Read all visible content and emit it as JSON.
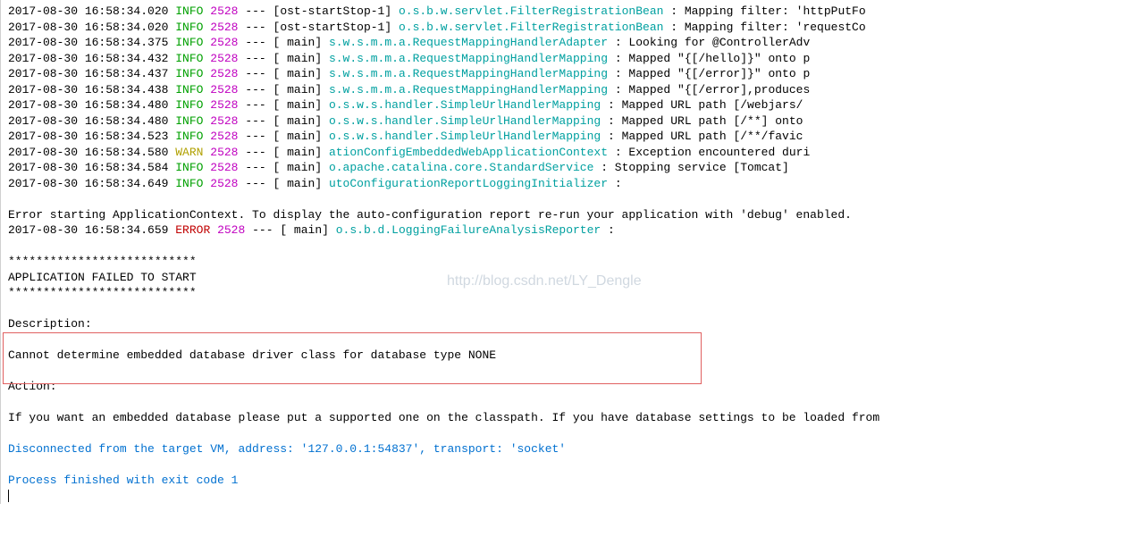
{
  "watermark": "http://blog.csdn.net/LY_Dengle",
  "log_lines": [
    {
      "ts": "2017-08-30 16:58:34.020",
      "lvl": "INFO",
      "pid": "2528",
      "sep": "---",
      "thread": "[ost-startStop-1]",
      "logger": "o.s.b.w.servlet.FilterRegistrationBean    ",
      "msg": ": Mapping filter: 'httpPutFo"
    },
    {
      "ts": "2017-08-30 16:58:34.020",
      "lvl": "INFO",
      "pid": "2528",
      "sep": "---",
      "thread": "[ost-startStop-1]",
      "logger": "o.s.b.w.servlet.FilterRegistrationBean    ",
      "msg": ": Mapping filter: 'requestCo"
    },
    {
      "ts": "2017-08-30 16:58:34.375",
      "lvl": "INFO",
      "pid": "2528",
      "sep": "---",
      "thread": "[           main]",
      "logger": "s.w.s.m.m.a.RequestMappingHandlerAdapter  ",
      "msg": ": Looking for @ControllerAdv"
    },
    {
      "ts": "2017-08-30 16:58:34.432",
      "lvl": "INFO",
      "pid": "2528",
      "sep": "---",
      "thread": "[           main]",
      "logger": "s.w.s.m.m.a.RequestMappingHandlerMapping  ",
      "msg": ": Mapped \"{[/hello]}\" onto p"
    },
    {
      "ts": "2017-08-30 16:58:34.437",
      "lvl": "INFO",
      "pid": "2528",
      "sep": "---",
      "thread": "[           main]",
      "logger": "s.w.s.m.m.a.RequestMappingHandlerMapping  ",
      "msg": ": Mapped \"{[/error]}\" onto p"
    },
    {
      "ts": "2017-08-30 16:58:34.438",
      "lvl": "INFO",
      "pid": "2528",
      "sep": "---",
      "thread": "[           main]",
      "logger": "s.w.s.m.m.a.RequestMappingHandlerMapping  ",
      "msg": ": Mapped \"{[/error],produces"
    },
    {
      "ts": "2017-08-30 16:58:34.480",
      "lvl": "INFO",
      "pid": "2528",
      "sep": "---",
      "thread": "[           main]",
      "logger": "o.s.w.s.handler.SimpleUrlHandlerMapping   ",
      "msg": ": Mapped URL path [/webjars/"
    },
    {
      "ts": "2017-08-30 16:58:34.480",
      "lvl": "INFO",
      "pid": "2528",
      "sep": "---",
      "thread": "[           main]",
      "logger": "o.s.w.s.handler.SimpleUrlHandlerMapping   ",
      "msg": ": Mapped URL path [/**] onto"
    },
    {
      "ts": "2017-08-30 16:58:34.523",
      "lvl": "INFO",
      "pid": "2528",
      "sep": "---",
      "thread": "[           main]",
      "logger": "o.s.w.s.handler.SimpleUrlHandlerMapping   ",
      "msg": ": Mapped URL path [/**/favic"
    },
    {
      "ts": "2017-08-30 16:58:34.580",
      "lvl": "WARN",
      "pid": "2528",
      "sep": "---",
      "thread": "[           main]",
      "logger": "ationConfigEmbeddedWebApplicationContext  ",
      "msg": ": Exception encountered duri"
    },
    {
      "ts": "2017-08-30 16:58:34.584",
      "lvl": "INFO",
      "pid": "2528",
      "sep": "---",
      "thread": "[           main]",
      "logger": "o.apache.catalina.core.StandardService    ",
      "msg": ": Stopping service [Tomcat]"
    },
    {
      "ts": "2017-08-30 16:58:34.649",
      "lvl": "INFO",
      "pid": "2528",
      "sep": "---",
      "thread": "[           main]",
      "logger": "utoConfigurationReportLoggingInitializer  ",
      "msg": ":"
    }
  ],
  "err_intro": "Error starting ApplicationContext. To display the auto-configuration report re-run your application with 'debug' enabled.",
  "err_line": {
    "ts": "2017-08-30 16:58:34.659",
    "lvl": "ERROR",
    "pid": "2528",
    "sep": "---",
    "thread": "[           main]",
    "logger": "o.s.b.d.LoggingFailureAnalysisReporter    ",
    "msg": ":"
  },
  "stars": "***************************",
  "app_failed": "APPLICATION FAILED TO START",
  "desc_head": "Description:",
  "desc_body": "Cannot determine embedded database driver class for database type NONE",
  "action_head": "Action:",
  "action_body": "If you want an embedded database please put a supported one on the classpath. If you have database settings to be loaded from ",
  "disconnect": "Disconnected from the target VM, address: '127.0.0.1:54837', transport: 'socket'",
  "exit": "Process finished with exit code 1"
}
